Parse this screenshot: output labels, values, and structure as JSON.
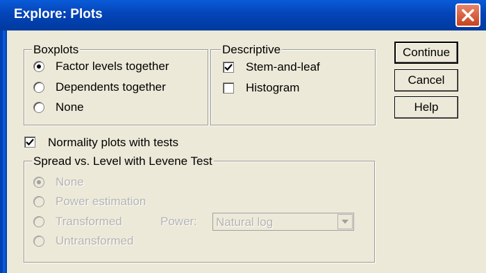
{
  "window": {
    "title": "Explore: Plots"
  },
  "boxplots": {
    "legend": "Boxplots",
    "options": [
      {
        "label": "Factor levels together",
        "selected": true
      },
      {
        "label": "Dependents together",
        "selected": false
      },
      {
        "label": "None",
        "selected": false
      }
    ]
  },
  "descriptive": {
    "legend": "Descriptive",
    "options": [
      {
        "label": "Stem-and-leaf",
        "checked": true
      },
      {
        "label": "Histogram",
        "checked": false
      }
    ]
  },
  "buttons": {
    "continue": "Continue",
    "cancel": "Cancel",
    "help": "Help"
  },
  "normality": {
    "label": "Normality plots with tests",
    "checked": true
  },
  "spread": {
    "legend": "Spread vs. Level with Levene Test",
    "options": [
      {
        "label": "None",
        "selected": true
      },
      {
        "label": "Power estimation",
        "selected": false
      },
      {
        "label": "Transformed",
        "selected": false
      },
      {
        "label": "Untransformed",
        "selected": false
      }
    ],
    "power_label": "Power:",
    "power_value": "Natural log"
  }
}
